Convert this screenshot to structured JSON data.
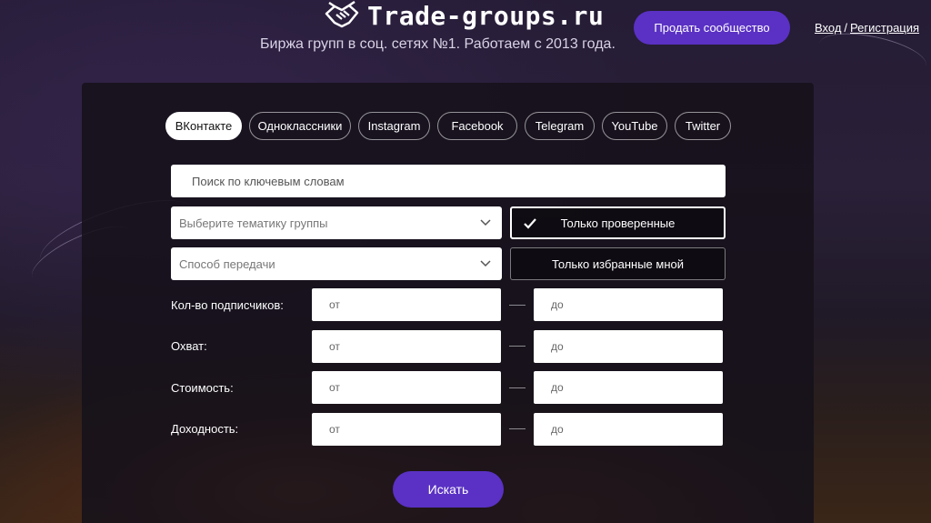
{
  "header": {
    "brand": "Trade-groups.ru",
    "tagline": "Биржа групп в соц. сетях №1. Работаем с 2013 года.",
    "sell_button": "Продать сообщество",
    "login": "Вход",
    "separator": "/",
    "register": "Регистрация"
  },
  "tabs": [
    {
      "label": "ВКонтакте",
      "active": true
    },
    {
      "label": "Одноклассники",
      "active": false
    },
    {
      "label": "Instagram",
      "active": false
    },
    {
      "label": "Facebook",
      "active": false
    },
    {
      "label": "Telegram",
      "active": false
    },
    {
      "label": "YouTube",
      "active": false
    },
    {
      "label": "Twitter",
      "active": false
    }
  ],
  "search": {
    "placeholder": "Поиск по ключевым словам"
  },
  "filters": {
    "topic_select": "Выберите тематику группы",
    "transfer_select": "Способ передачи",
    "verified_toggle": {
      "label": "Только проверенные",
      "checked": true
    },
    "favorites_toggle": {
      "label": "Только избранные мной",
      "checked": false
    }
  },
  "ranges": [
    {
      "label": "Кол-во подписчиков:",
      "from": "от",
      "to": "до"
    },
    {
      "label": "Охват:",
      "from": "от",
      "to": "до"
    },
    {
      "label": "Стоимость:",
      "from": "от",
      "to": "до"
    },
    {
      "label": "Доходность:",
      "from": "от",
      "to": "до"
    }
  ],
  "submit_button": "Искать",
  "colors": {
    "accent": "#5a31c4",
    "panel": "#16111a"
  }
}
